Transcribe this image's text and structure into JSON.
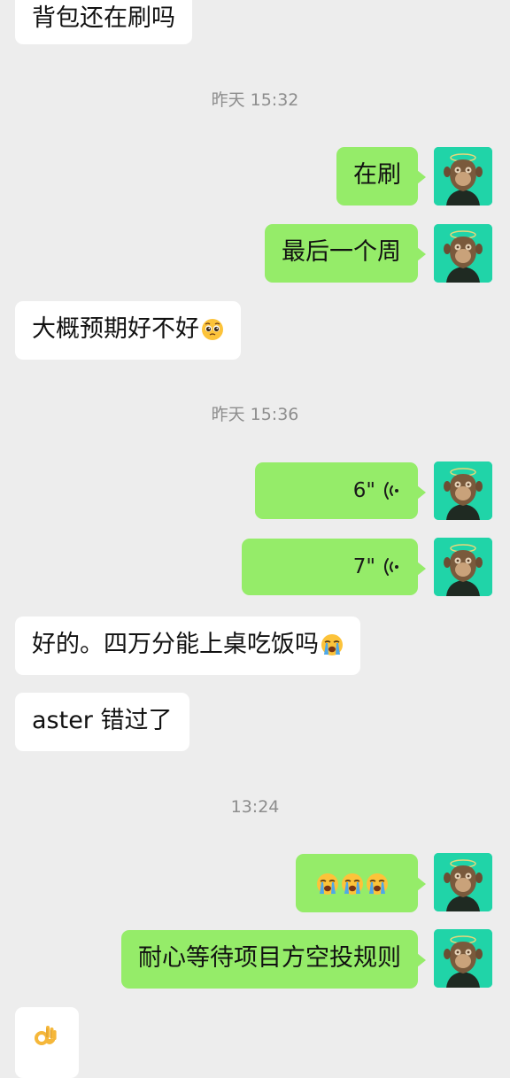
{
  "colors": {
    "background": "#ededed",
    "bubble_self": "#95ec69",
    "bubble_other": "#ffffff",
    "avatar_bg": "#20d4a8",
    "timestamp": "#8d8d8d"
  },
  "messages": {
    "m1": {
      "text": "背包还在刷吗"
    },
    "t1": {
      "text": "昨天 15:32"
    },
    "m2": {
      "text": "在刷"
    },
    "m3": {
      "text": "最后一个周"
    },
    "m4": {
      "text": "大概预期好不好",
      "emoji": "pleading-face-icon"
    },
    "t2": {
      "text": "昨天 15:36"
    },
    "v1": {
      "duration": "6\"",
      "icon": "voice-wave-icon"
    },
    "v2": {
      "duration": "7\"",
      "icon": "voice-wave-icon"
    },
    "m5": {
      "text": "好的。四万分能上桌吃饭吗",
      "emoji": "loudly-crying-face-icon"
    },
    "m6": {
      "text": "aster 错过了"
    },
    "t3": {
      "text": "13:24"
    },
    "m7": {
      "emojis": [
        "loudly-crying-face-icon",
        "loudly-crying-face-icon",
        "loudly-crying-face-icon"
      ]
    },
    "m8": {
      "text": "耐心等待项目方空投规则"
    },
    "m9": {
      "emoji": "ok-hand-icon"
    }
  }
}
